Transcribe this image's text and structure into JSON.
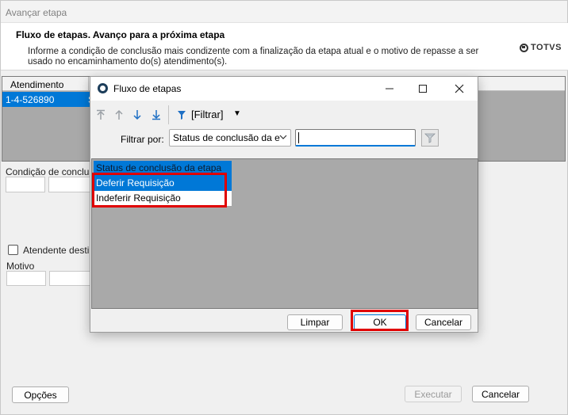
{
  "window": {
    "title": "Avançar etapa",
    "header_title": "Fluxo de etapas. Avanço para a próxima etapa",
    "header_desc": "Informe a condição de conclusão mais condizente com a finalização da etapa atual e o motivo de repasse a ser usado no encaminhamento do(s) atendimento(s).",
    "logo_text": "TOTVS"
  },
  "grid": {
    "col_atendimento": "Atendimento",
    "col_second": "A",
    "row_id": "1-4-526890",
    "row_second": "S"
  },
  "form": {
    "condicao_label": "Condição de conclusã",
    "atendente_label": "Atendente destino",
    "motivo_label": "Motivo"
  },
  "footer": {
    "opcoes": "Opções",
    "executar": "Executar",
    "cancelar": "Cancelar"
  },
  "dialog": {
    "title": "Fluxo de etapas",
    "filter_button_label": "[Filtrar]",
    "filter_by_label": "Filtrar por:",
    "filter_select_value": "Status de conclusão da e",
    "filter_text_value": "",
    "list_header": "Status de conclusão da etapa",
    "list_items": [
      "Deferir Requisição",
      "Indeferir Requisição"
    ],
    "limpar": "Limpar",
    "ok": "OK",
    "cancelar": "Cancelar"
  },
  "colors": {
    "accent": "#0078d7",
    "highlight": "#e00000",
    "grid_bg": "#a9a9a9"
  }
}
